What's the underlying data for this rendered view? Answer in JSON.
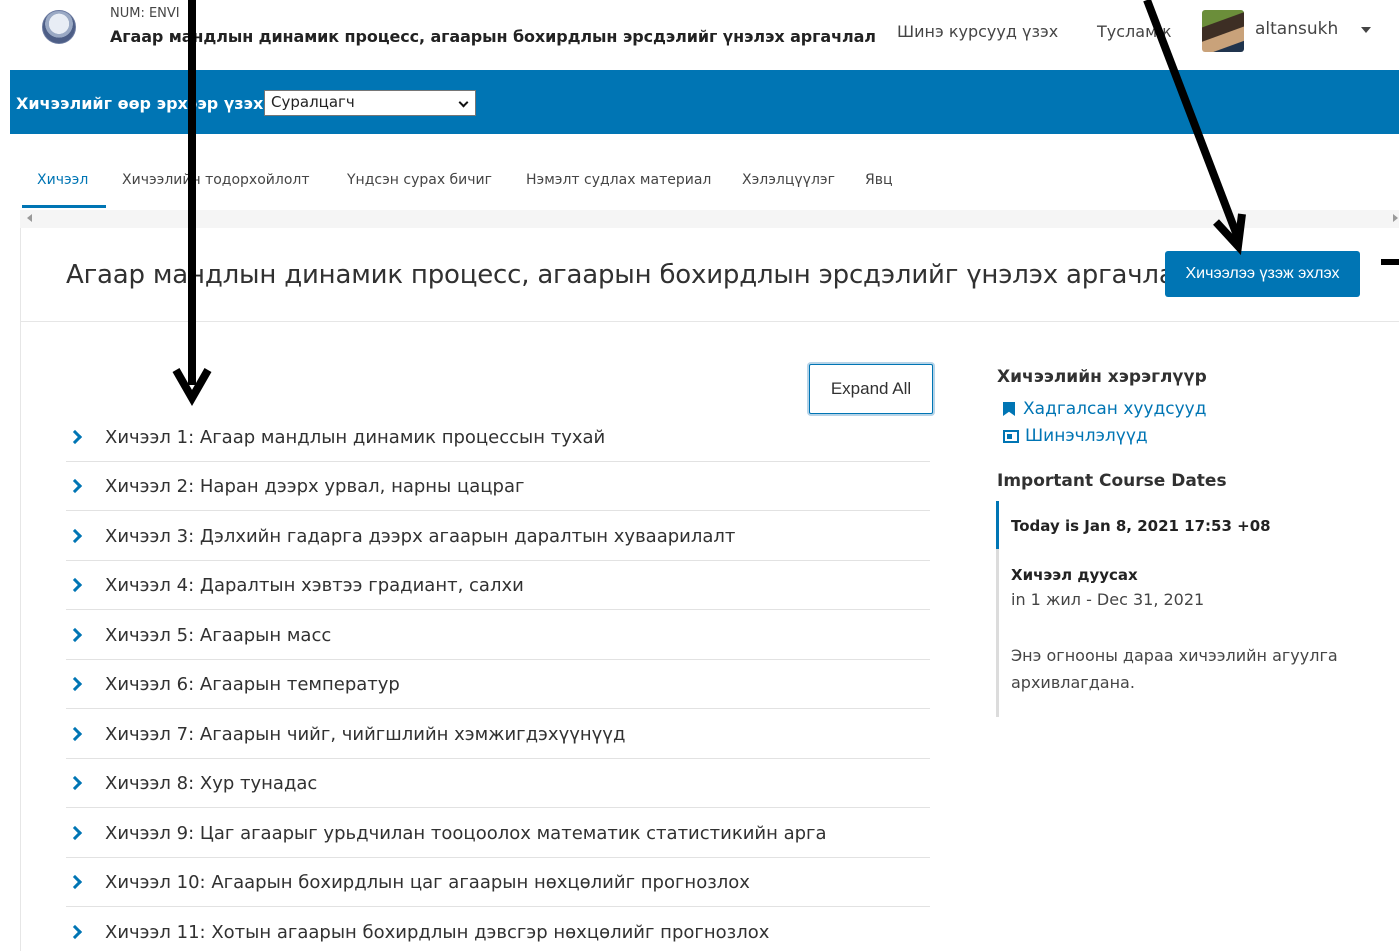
{
  "header": {
    "org_label": "NUM: ENVI",
    "course_title": "Агаар мандлын динамик процесс, агаарын бохирдлын эрсдэлийг үнэлэх аргачлал",
    "new_courses_link": "Шинэ курсууд үзэх",
    "help_link": "Тусламж",
    "username": "altansukh"
  },
  "role_bar": {
    "label": "Хичээлийг өөр эрхээр үзэх:",
    "selected_role": "Суралцагч"
  },
  "tabs": [
    {
      "label": "Хичээл",
      "active": true
    },
    {
      "label": "Хичээлийн тодорхойлолт",
      "active": false
    },
    {
      "label": "Үндсэн сурах бичиг",
      "active": false
    },
    {
      "label": "Нэмэлт судлах материал",
      "active": false
    },
    {
      "label": "Хэлэлцүүлэг",
      "active": false
    },
    {
      "label": "Явц",
      "active": false
    }
  ],
  "course": {
    "heading": "Агаар мандлын динамик процесс, агаарын бохирдлын эрсдэлийг үнэлэх аргачлал",
    "start_button": "Хичээлээ үзэж эхлэх",
    "expand_all": "Expand All",
    "lessons": [
      "Хичээл 1: Агаар мандлын динамик процессын тухай",
      "Хичээл 2: Наран дээрх урвал, нарны цацраг",
      "Хичээл 3: Дэлхийн гадарга дээрх агаарын даралтын хуваарилалт",
      "Хичээл 4: Даралтын хэвтээ градиант, салхи",
      "Хичээл 5: Агаарын масс",
      "Хичээл 6: Агаарын температур",
      "Хичээл 7: Агаарын чийг, чийгшлийн хэмжигдэхүүнүүд",
      "Хичээл 8: Хур тунадас",
      "Хичээл 9: Цаг агаарыг урьдчилан тооцоолох математик статистикийн арга",
      "Хичээл 10: Агаарын бохирдлын цаг агаарын нөхцөлийг прогнозлох",
      "Хичээл 11: Хотын агаарын бохирдлын дэвсгэр нөхцөлийг прогнозлох"
    ]
  },
  "sidebar": {
    "tools_heading": "Хичээлийн хэрэглүүр",
    "bookmarks_link": "Хадгалсан хуудсууд",
    "updates_link": "Шинэчлэлүүд",
    "dates_heading": "Important Course Dates",
    "today": "Today is Jan 8, 2021 17:53 +08",
    "end_label": "Хичээл дуусах",
    "end_date": "in 1 жил - Dec 31, 2021",
    "archive_note_line1": "Энэ огнооны дараа хичээлийн агуулга",
    "archive_note_line2": "архивлагдана."
  },
  "colors": {
    "brand_blue": "#0075b4",
    "annotation": "#000000"
  }
}
